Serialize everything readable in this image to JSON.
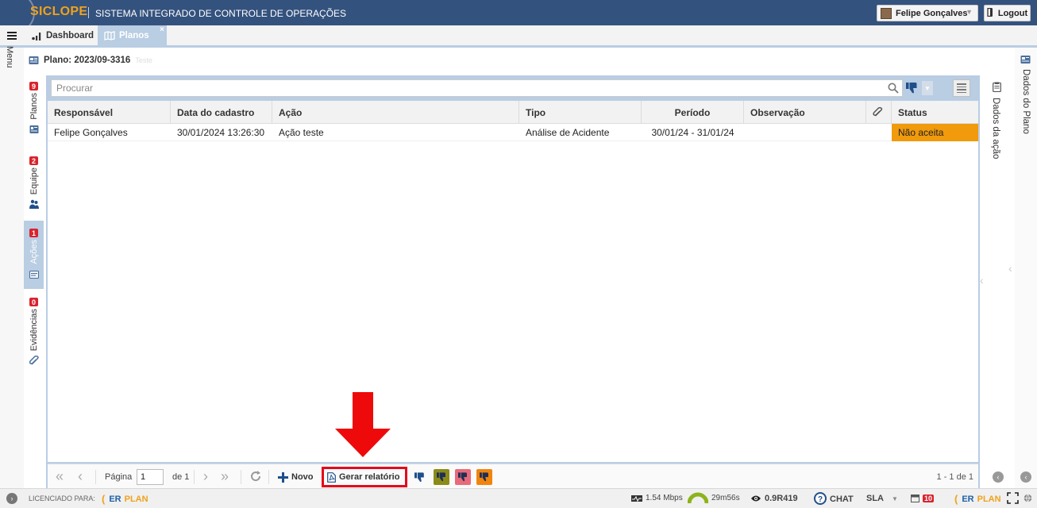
{
  "header": {
    "logo": "SICLOPE",
    "app_title": "SISTEMA INTEGRADO DE CONTROLE DE OPERAÇÕES",
    "user_name": "Felipe Gonçalves",
    "logout_label": "Logout"
  },
  "tabs": {
    "dashboard": "Dashboard",
    "planos": "Planos",
    "close_symbol": "×"
  },
  "menu_label": "Menu",
  "plan": {
    "title": "Plano: 2023/09-3316",
    "subtitle": "Teste"
  },
  "vertical_tabs": [
    {
      "label": "Planos",
      "badge": "9"
    },
    {
      "label": "Equipe",
      "badge": "2"
    },
    {
      "label": "Ações",
      "badge": "1"
    },
    {
      "label": "Evidências",
      "badge": "0"
    }
  ],
  "search": {
    "placeholder": "Procurar"
  },
  "table": {
    "columns": [
      "Responsável",
      "Data do cadastro",
      "Ação",
      "Tipo",
      "Período",
      "Observação",
      "",
      "Status"
    ],
    "rows": [
      {
        "responsavel": "Felipe Gonçalves",
        "data_cadastro": "30/01/2024 13:26:30",
        "acao": "Ação teste",
        "tipo": "Análise de Acidente",
        "periodo": "30/01/24 - 31/01/24",
        "observacao": "",
        "status": "Não aceita",
        "status_color": "#f09a0c"
      }
    ]
  },
  "pager": {
    "page_label": "Página",
    "page_value": "1",
    "of_label": "de 1",
    "new_label": "Novo",
    "report_label": "Gerar relatório",
    "info": "1 - 1 de 1"
  },
  "status_filter_colors": [
    "#1f4f8a",
    "#8b8b1a",
    "#e86a7a",
    "#f0850e"
  ],
  "right_panels": {
    "acao": "Dados da ação",
    "plano": "Dados do Plano"
  },
  "footer": {
    "licensed_label": "LICENCIADO PARA:",
    "speed": "1.54 Mbps",
    "timer": "29m56s",
    "version": "0.9R419",
    "chat": "CHAT",
    "sla": "SLA",
    "notif_count": "10",
    "erplan_er": "ER",
    "erplan_plan": "PLAN"
  },
  "colors": {
    "header_bg": "#34527e",
    "logo": "#f0a21a",
    "accent": "#b9cde3",
    "highlight_red": "#e4091a"
  }
}
